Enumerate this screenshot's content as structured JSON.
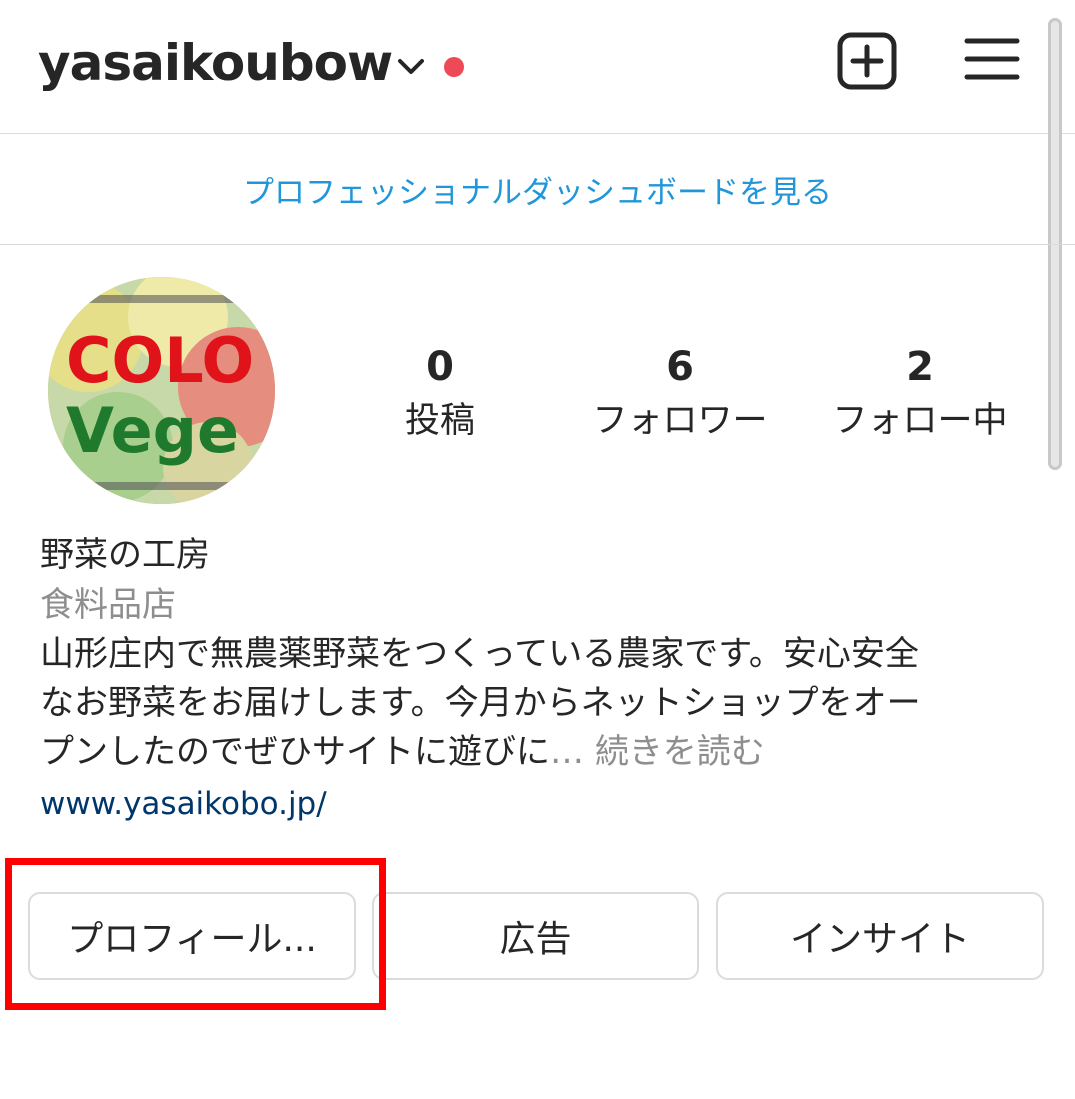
{
  "header": {
    "username": "yasaikoubow",
    "chevron_icon": "chevron-down-icon",
    "notification_dot_color": "#ed4956",
    "create_icon": "plus-square-icon",
    "menu_icon": "hamburger-menu-icon"
  },
  "dashboard": {
    "link_label": "プロフェッショナルダッシュボードを見る",
    "link_color": "#2196d9"
  },
  "profile": {
    "avatar": {
      "image_text_line1": "COLO",
      "image_text_line2": "Vege"
    },
    "stats": [
      {
        "value": "0",
        "label": "投稿"
      },
      {
        "value": "6",
        "label": "フォロワー"
      },
      {
        "value": "2",
        "label": "フォロー中"
      }
    ],
    "name": "野菜の工房",
    "category": "食料品店",
    "bio_line1": "山形庄内で無農薬野菜をつくっている農家です。安心安全",
    "bio_line2": "なお野菜をお届けします。今月からネットショップをオー",
    "bio_line3": "プンしたのでぜひサイトに遊びに",
    "bio_ellipsis": "…",
    "more_label": "続きを読む",
    "website": "www.yasaikobo.jp/"
  },
  "actions": {
    "profile_button": "プロフィール...",
    "ads_button": "広告",
    "insight_button": "インサイト"
  },
  "annotation": {
    "highlight_color": "#ff0000"
  }
}
